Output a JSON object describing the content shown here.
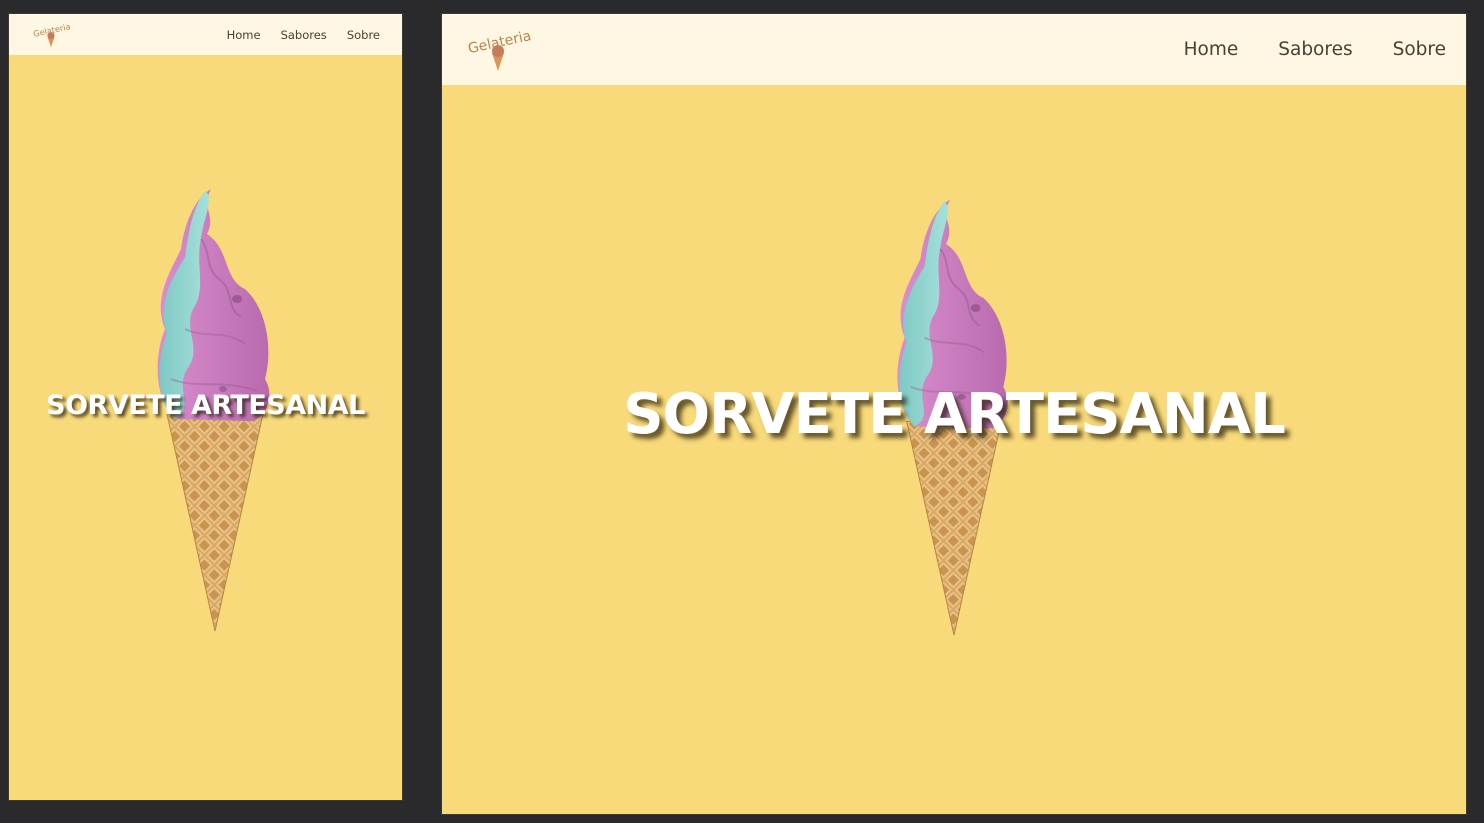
{
  "brand": {
    "logo_text": "Gelateria"
  },
  "nav": {
    "items": [
      {
        "label": "Home"
      },
      {
        "label": "Sabores"
      },
      {
        "label": "Sobre"
      }
    ]
  },
  "hero": {
    "title": "SORVETE ARTESANAL",
    "image": "soft-serve-ice-cream-cone"
  },
  "colors": {
    "page_background": "#2a2a2c",
    "hero_background": "#f8da7a",
    "navbar_background": "#fdf7e3",
    "nav_text": "#4a4036",
    "logo": "#b8864a",
    "title_text": "#ffffff"
  }
}
